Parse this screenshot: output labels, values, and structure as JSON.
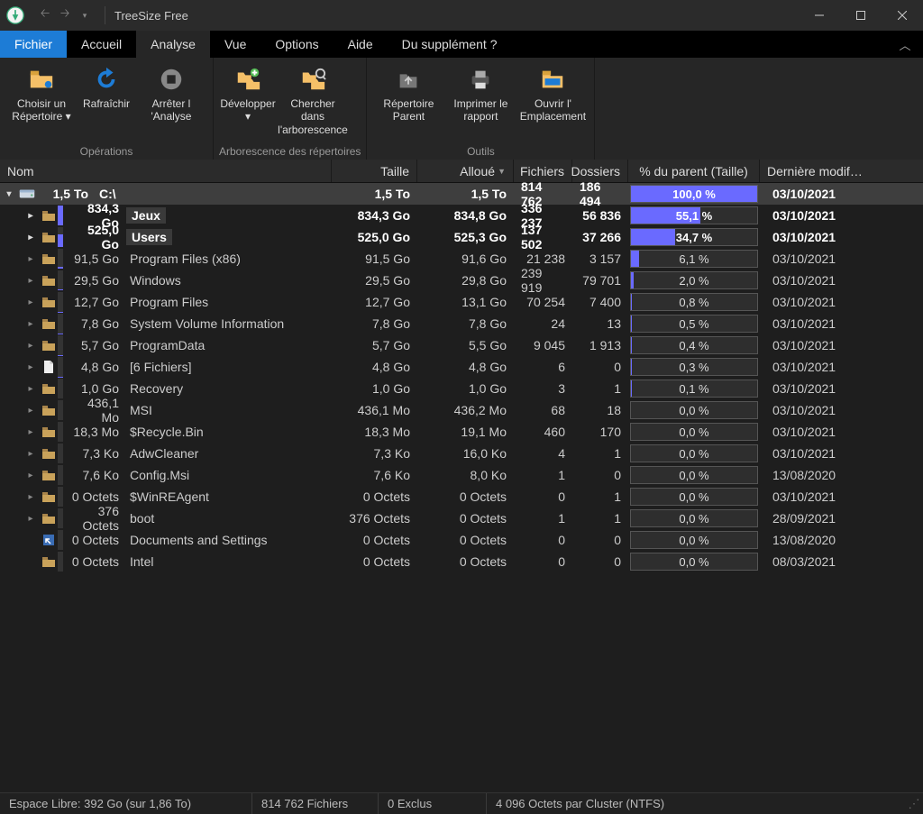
{
  "app_title": "TreeSize Free",
  "menu": {
    "items": [
      "Fichier",
      "Accueil",
      "Analyse",
      "Vue",
      "Options",
      "Aide",
      "Du supplément ?"
    ],
    "active_blue": 0,
    "active_tab": 2
  },
  "ribbon": {
    "groups": [
      {
        "label": "Opérations",
        "buttons": [
          {
            "label": "Choisir un Répertoire ▾",
            "icon": "folder-pick"
          },
          {
            "label": "Rafraîchir",
            "icon": "refresh"
          },
          {
            "label": "Arrêter l 'Analyse",
            "icon": "stop"
          }
        ]
      },
      {
        "label": "Arborescence des répertoires",
        "buttons": [
          {
            "label": "Développer ▾",
            "icon": "expand"
          },
          {
            "label": "Chercher dans l'arborescence",
            "icon": "search-tree"
          }
        ]
      },
      {
        "label": "Outils",
        "buttons": [
          {
            "label": "Répertoire Parent",
            "icon": "parent"
          },
          {
            "label": "Imprimer le rapport",
            "icon": "print"
          },
          {
            "label": "Ouvrir l' Emplacement",
            "icon": "open-loc"
          }
        ]
      }
    ]
  },
  "columns": [
    "Nom",
    "Taille",
    "Alloué",
    "Fichiers",
    "Dossiers",
    "% du parent (Taille)",
    "Dernière modif…"
  ],
  "sort_col": 2,
  "rows": [
    {
      "level": 0,
      "exp": "v",
      "icon": "disk",
      "size": "1,5 To",
      "name": "C:\\",
      "taille": "1,5 To",
      "alloue": "1,5 To",
      "fichiers": "814 762",
      "dossiers": "186 494",
      "pct": "100,0 %",
      "pct_val": 100,
      "date": "03/10/2021",
      "root": true,
      "bold": true
    },
    {
      "level": 1,
      "exp": ">",
      "icon": "folder",
      "size": "834,3 Go",
      "name": "Jeux",
      "taille": "834,3 Go",
      "alloue": "834,8 Go",
      "fichiers": "336 237",
      "dossiers": "56 836",
      "pct": "55,1 %",
      "pct_val": 55.1,
      "date": "03/10/2021",
      "bold": true,
      "bar": 100,
      "pill": true
    },
    {
      "level": 1,
      "exp": ">",
      "icon": "folder",
      "size": "525,0 Go",
      "name": "Users",
      "taille": "525,0 Go",
      "alloue": "525,3 Go",
      "fichiers": "137 502",
      "dossiers": "37 266",
      "pct": "34,7 %",
      "pct_val": 34.7,
      "date": "03/10/2021",
      "bold": true,
      "bar": 63,
      "pill": true
    },
    {
      "level": 1,
      "exp": ">",
      "icon": "folder",
      "size": "91,5 Go",
      "name": "Program Files (x86)",
      "taille": "91,5 Go",
      "alloue": "91,6 Go",
      "fichiers": "21 238",
      "dossiers": "3 157",
      "pct": "6,1 %",
      "pct_val": 6.1,
      "date": "03/10/2021",
      "bar": 11
    },
    {
      "level": 1,
      "exp": ">",
      "icon": "folder",
      "size": "29,5 Go",
      "name": "Windows",
      "taille": "29,5 Go",
      "alloue": "29,8 Go",
      "fichiers": "239 919",
      "dossiers": "79 701",
      "pct": "2,0 %",
      "pct_val": 2.0,
      "date": "03/10/2021",
      "bar": 4
    },
    {
      "level": 1,
      "exp": ">",
      "icon": "folder",
      "size": "12,7 Go",
      "name": "Program Files",
      "taille": "12,7 Go",
      "alloue": "13,1 Go",
      "fichiers": "70 254",
      "dossiers": "7 400",
      "pct": "0,8 %",
      "pct_val": 0.8,
      "date": "03/10/2021",
      "bar": 2
    },
    {
      "level": 1,
      "exp": ">",
      "icon": "folder",
      "size": "7,8 Go",
      "name": "System Volume Information",
      "taille": "7,8 Go",
      "alloue": "7,8 Go",
      "fichiers": "24",
      "dossiers": "13",
      "pct": "0,5 %",
      "pct_val": 0.5,
      "date": "03/10/2021",
      "bar": 1
    },
    {
      "level": 1,
      "exp": ">",
      "icon": "folder",
      "size": "5,7 Go",
      "name": "ProgramData",
      "taille": "5,7 Go",
      "alloue": "5,5 Go",
      "fichiers": "9 045",
      "dossiers": "1 913",
      "pct": "0,4 %",
      "pct_val": 0.4,
      "date": "03/10/2021",
      "bar": 1
    },
    {
      "level": 1,
      "exp": ">",
      "icon": "file",
      "size": "4,8 Go",
      "name": "[6 Fichiers]",
      "taille": "4,8 Go",
      "alloue": "4,8 Go",
      "fichiers": "6",
      "dossiers": "0",
      "pct": "0,3 %",
      "pct_val": 0.3,
      "date": "03/10/2021",
      "bar": 1
    },
    {
      "level": 1,
      "exp": ">",
      "icon": "folder",
      "size": "1,0 Go",
      "name": "Recovery",
      "taille": "1,0 Go",
      "alloue": "1,0 Go",
      "fichiers": "3",
      "dossiers": "1",
      "pct": "0,1 %",
      "pct_val": 0.1,
      "date": "03/10/2021",
      "bar": 0
    },
    {
      "level": 1,
      "exp": ">",
      "icon": "folder",
      "size": "436,1 Mo",
      "name": "MSI",
      "taille": "436,1 Mo",
      "alloue": "436,2 Mo",
      "fichiers": "68",
      "dossiers": "18",
      "pct": "0,0 %",
      "pct_val": 0,
      "date": "03/10/2021",
      "bar": 0
    },
    {
      "level": 1,
      "exp": ">",
      "icon": "folder",
      "size": "18,3 Mo",
      "name": "$Recycle.Bin",
      "taille": "18,3 Mo",
      "alloue": "19,1 Mo",
      "fichiers": "460",
      "dossiers": "170",
      "pct": "0,0 %",
      "pct_val": 0,
      "date": "03/10/2021",
      "bar": 0
    },
    {
      "level": 1,
      "exp": ">",
      "icon": "folder",
      "size": "7,3 Ko",
      "name": "AdwCleaner",
      "taille": "7,3 Ko",
      "alloue": "16,0 Ko",
      "fichiers": "4",
      "dossiers": "1",
      "pct": "0,0 %",
      "pct_val": 0,
      "date": "03/10/2021",
      "bar": 0
    },
    {
      "level": 1,
      "exp": ">",
      "icon": "folder",
      "size": "7,6 Ko",
      "name": "Config.Msi",
      "taille": "7,6 Ko",
      "alloue": "8,0 Ko",
      "fichiers": "1",
      "dossiers": "0",
      "pct": "0,0 %",
      "pct_val": 0,
      "date": "13/08/2020",
      "bar": 0
    },
    {
      "level": 1,
      "exp": ">",
      "icon": "folder",
      "size": "0 Octets",
      "name": "$WinREAgent",
      "taille": "0 Octets",
      "alloue": "0 Octets",
      "fichiers": "0",
      "dossiers": "1",
      "pct": "0,0 %",
      "pct_val": 0,
      "date": "03/10/2021",
      "bar": 0
    },
    {
      "level": 1,
      "exp": ">",
      "icon": "folder",
      "size": "376 Octets",
      "name": "boot",
      "taille": "376 Octets",
      "alloue": "0 Octets",
      "fichiers": "1",
      "dossiers": "1",
      "pct": "0,0 %",
      "pct_val": 0,
      "date": "28/09/2021",
      "bar": 0
    },
    {
      "level": 1,
      "exp": "",
      "icon": "shortcut",
      "size": "0 Octets",
      "name": "Documents and Settings",
      "taille": "0 Octets",
      "alloue": "0 Octets",
      "fichiers": "0",
      "dossiers": "0",
      "pct": "0,0 %",
      "pct_val": 0,
      "date": "13/08/2020",
      "bar": 0
    },
    {
      "level": 1,
      "exp": "",
      "icon": "folder",
      "size": "0 Octets",
      "name": "Intel",
      "taille": "0 Octets",
      "alloue": "0 Octets",
      "fichiers": "0",
      "dossiers": "0",
      "pct": "0,0 %",
      "pct_val": 0,
      "date": "08/03/2021",
      "bar": 0
    }
  ],
  "statusbar": {
    "free": "Espace Libre: 392 Go  (sur 1,86 To)",
    "files": "814 762 Fichiers",
    "excl": "0 Exclus",
    "cluster": "4 096 Octets par Cluster (NTFS)"
  }
}
